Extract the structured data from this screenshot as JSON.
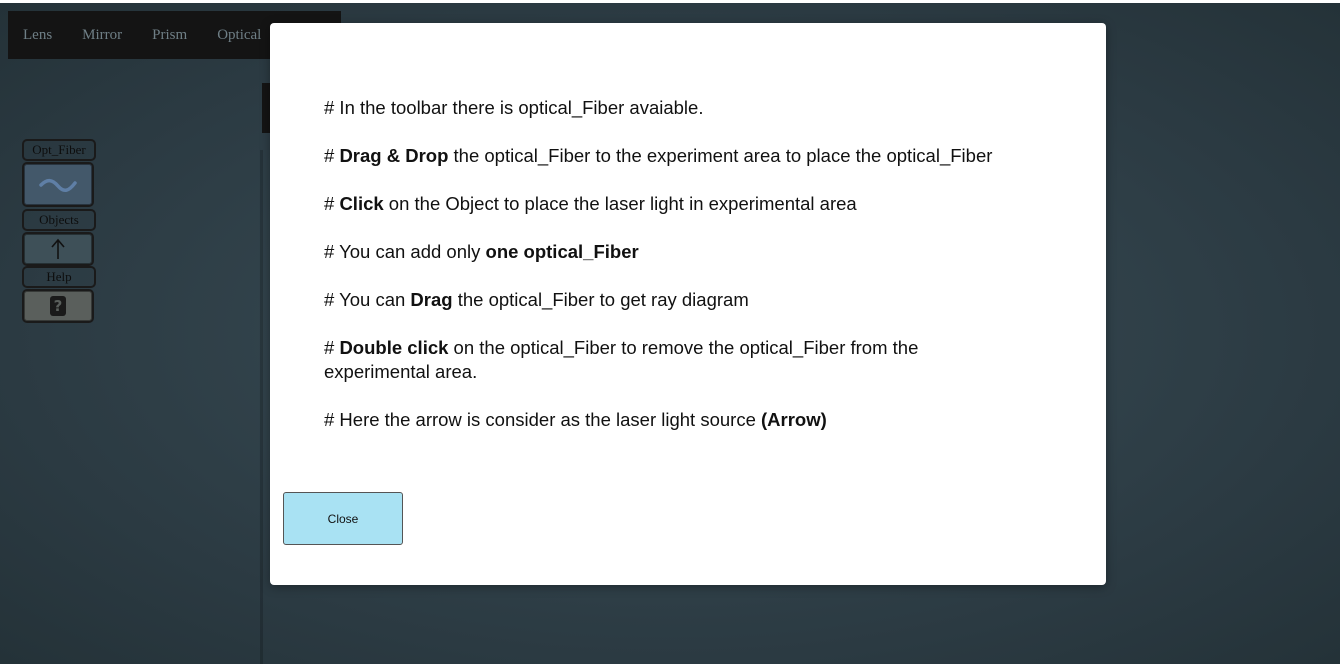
{
  "topnav": {
    "items": [
      "Lens",
      "Mirror",
      "Prism",
      "Optical"
    ]
  },
  "toolbar": {
    "opt_fiber_label": "Opt_Fiber",
    "opt_fiber_icon": "fiber-wave-icon",
    "objects_label": "Objects",
    "objects_icon": "arrow-up-icon",
    "help_label": "Help",
    "help_icon": "question-mark-icon",
    "help_glyph": "?"
  },
  "modal": {
    "lines": [
      {
        "pre": "# In the toolbar there is optical_Fiber avaiable.",
        "bold": "",
        "post": ""
      },
      {
        "pre": "# ",
        "bold": "Drag & Drop",
        "post": " the optical_Fiber to the experiment area to place the optical_Fiber"
      },
      {
        "pre": "# ",
        "bold": "Click",
        "post": " on the Object to place the laser light in experimental area"
      },
      {
        "pre": "# You can add only ",
        "bold": "one optical_Fiber",
        "post": ""
      },
      {
        "pre": "# You can ",
        "bold": "Drag",
        "post": " the optical_Fiber to get ray diagram"
      },
      {
        "pre": "# ",
        "bold": "Double click",
        "post": " on the optical_Fiber to remove the optical_Fiber from the experimental area."
      },
      {
        "pre": "# Here the arrow is consider as the laser light source ",
        "bold": "(Arrow)",
        "post": ""
      }
    ],
    "close_label": "Close"
  },
  "colors": {
    "background": "#2f3f47",
    "close_button": "#a9e2f3",
    "nav_bg": "#141414"
  }
}
